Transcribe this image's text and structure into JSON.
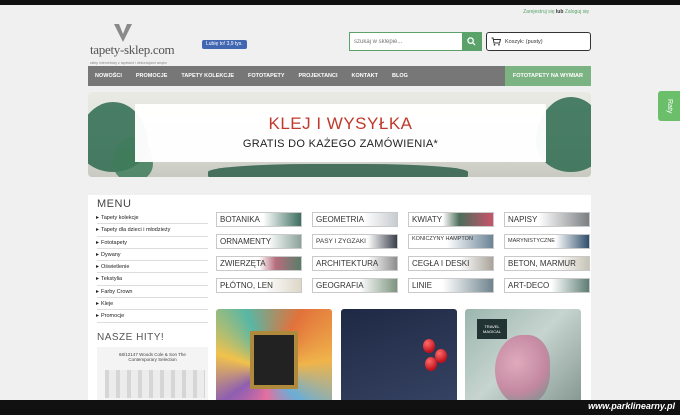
{
  "top_links": {
    "register": "Zarejestruj się",
    "or": "lub",
    "login": "Zaloguj się"
  },
  "logo": {
    "name": "tapety-sklep.com",
    "tagline": "sklep internetowy z tapetami i dekoracjami wnętrz"
  },
  "facebook": {
    "label": "Lubię to! 3,9 tys."
  },
  "search": {
    "placeholder": "szukaj w sklepie..."
  },
  "cart": {
    "label": "Koszyk: (pusty)"
  },
  "nav": {
    "items": [
      "NOWOŚCI",
      "PROMOCJE",
      "TAPETY KOLEKCJE",
      "FOTOTAPETY",
      "PROJEKTANCI",
      "KONTAKT",
      "BLOG"
    ],
    "cta": "FOTOTAPETY NA WYMIAR"
  },
  "banner": {
    "title": "KLEJ I WYSYŁKA",
    "subtitle": "GRATIS DO KAŻEGO ZAMÓWIENIA*"
  },
  "menu": {
    "title": "MENU",
    "items": [
      "Tapety kolekcje",
      "Tapety dla dzieci i młodzieży",
      "Fototapety",
      "Dywany",
      "Oświetlenie",
      "Tekstylia",
      "Farby Crown",
      "Kleje",
      "Promocje"
    ]
  },
  "hits": {
    "title": "NASZE HITY!",
    "product": "68/12147 Woods Cole & Son The Contemporary Selection"
  },
  "categories": [
    "BOTANIKA",
    "GEOMETRIA",
    "KWIATY",
    "NAPISY",
    "ORNAMENTY",
    "PASY I ZYGZAKI",
    "KONICZYNY HAMPTON",
    "MARYNISTYCZNE",
    "ZWIERZĘTA",
    "ARCHITEKTURA",
    "CEGŁA I DESKI",
    "BETON, MARMUR",
    "PŁÓTNO, LEN",
    "GEOGRAFIA",
    "LINIE",
    "ART-DECO"
  ],
  "products": {
    "p3_tag": "TRAVEL MAGICAL"
  },
  "side_tab": {
    "label": "Raty"
  },
  "watermark": "www.parklinearny.pl"
}
